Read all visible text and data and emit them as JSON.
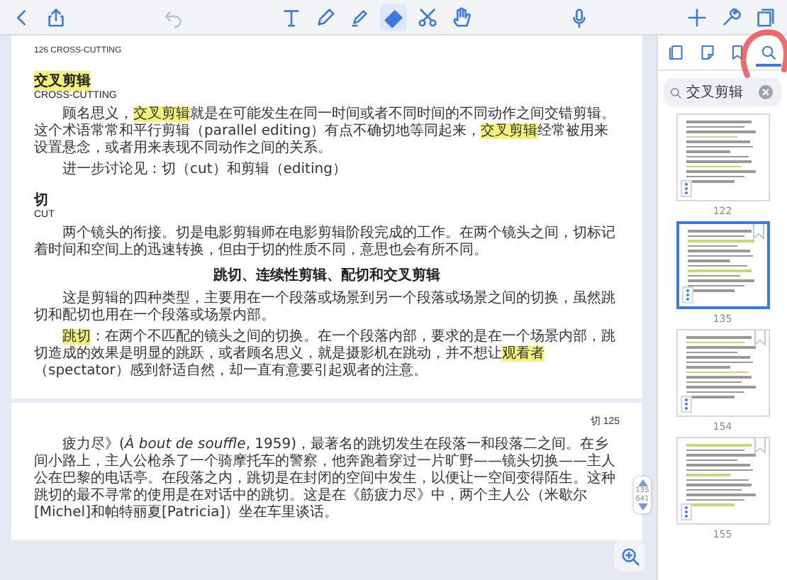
{
  "toolbar": {
    "undo_disabled": true,
    "tools": [
      {
        "kind": "text",
        "selected": false
      },
      {
        "kind": "pen",
        "selected": false
      },
      {
        "kind": "highlighter",
        "selected": false
      },
      {
        "kind": "eraser",
        "selected": true
      },
      {
        "kind": "scissors",
        "selected": false
      },
      {
        "kind": "hand",
        "selected": false
      }
    ]
  },
  "pages": [
    {
      "header": "126  CROSS-CUTTING",
      "blocks": [
        {
          "kind": "title",
          "text": "交叉剪辑",
          "highlight": true
        },
        {
          "kind": "subtitle",
          "text": "CROSS-CUTTING"
        },
        {
          "kind": "para",
          "text": "顾名思义，**交叉剪辑**就是在可能发生在同一时间或者不同时间的不同动作之间交错剪辑。这个术语常常和平行剪辑（parallel editing）有点不确切地等同起来，**交叉剪辑**经常被用来设置悬念，或者用来表现不同动作之间的关系。"
        },
        {
          "kind": "para",
          "text": "进一步讨论见：切（cut）和剪辑（editing）"
        },
        {
          "kind": "title",
          "text": "切",
          "highlight": false
        },
        {
          "kind": "subtitle",
          "text": "CUT"
        },
        {
          "kind": "para",
          "text": "两个镜头的衔接。切是电影剪辑师在电影剪辑阶段完成的工作。在两个镜头之间，切标记着时间和空间上的迅速转换，但由于切的性质不同，意思也会有所不同。"
        },
        {
          "kind": "heading",
          "text": "跳切、连续性剪辑、配切和交叉剪辑"
        },
        {
          "kind": "para",
          "text": "这是剪辑的四种类型，主要用在一个段落或场景到另一个段落或场景之间的切换，虽然跳切和配切也用在一个段落或场景内部。"
        },
        {
          "kind": "para",
          "text": "**跳切**：在两个不匹配的镜头之间的切换。在一个段落内部，要求的是在一个场景内部，跳切造成的效果是明显的跳跃，或者顾名思义，就是摄影机在跳动，并不想让**观看者**（spectator）感到舒适自然，却一直有意要引起观者的注意。"
        }
      ]
    },
    {
      "header": "切  125",
      "blocks": [
        {
          "kind": "para",
          "text": "疲力尽》(*À bout de souffle*, 1959)，最著名的跳切发生在段落一和段落二之间。在乡间小路上，主人公枪杀了一个骑摩托车的警察，他奔跑着穿过一片旷野——镜头切换——主人公在巴黎的电话亭。在段落之内，跳切是在封闭的空间中发生，以便让一空间变得陌生。这种跳切的最不寻常的使用是在对话中的跳切。这是在《筋疲力尽》中，两个主人公（米歇尔[Michel]和帕特丽夏[Patricia]）坐在车里谈话。"
        }
      ]
    }
  ],
  "sidebar": {
    "tabs": [
      {
        "kind": "pages",
        "selected": false
      },
      {
        "kind": "notes",
        "selected": false
      },
      {
        "kind": "bookmarks",
        "selected": false
      },
      {
        "kind": "search",
        "selected": true
      }
    ],
    "search": {
      "value": "交叉剪辑"
    },
    "thumbnails": [
      {
        "label": "122",
        "selected": false,
        "bookmarked": false
      },
      {
        "label": "135",
        "selected": true,
        "bookmarked": true
      },
      {
        "label": "154",
        "selected": false,
        "bookmarked": true
      },
      {
        "label": "155",
        "selected": false,
        "bookmarked": true
      }
    ]
  },
  "page_indicator": {
    "current": "135",
    "total": "641"
  }
}
